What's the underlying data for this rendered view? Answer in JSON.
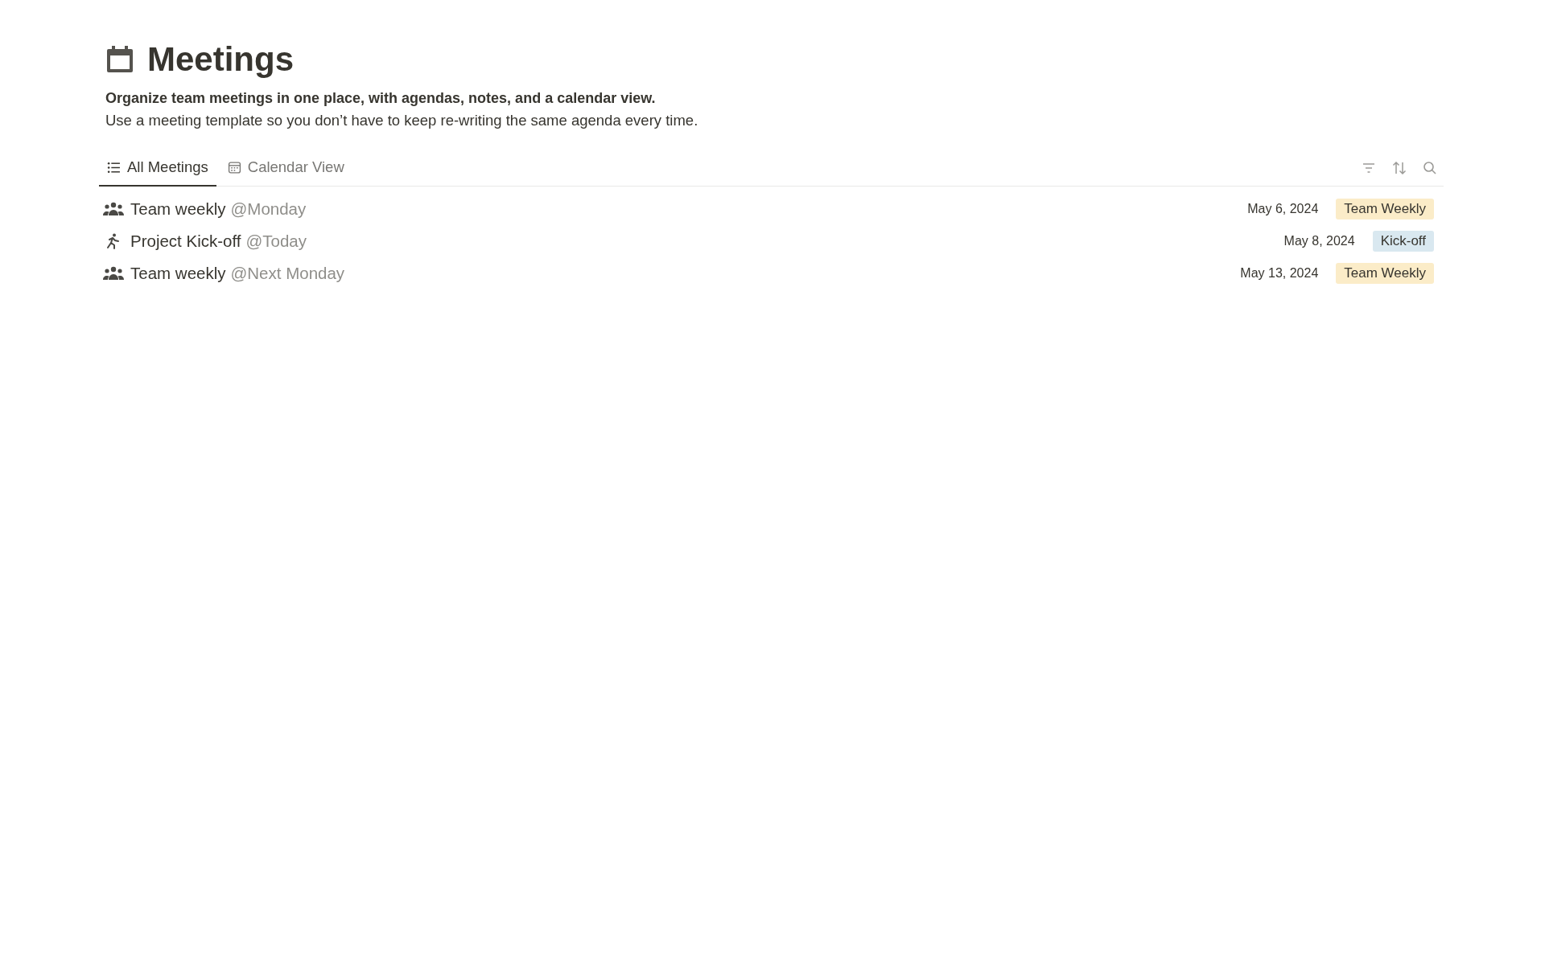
{
  "page": {
    "title": "Meetings",
    "subtitle": "Organize team meetings in one place, with agendas, notes, and a calendar view.",
    "description": "Use a meeting template so you don’t have to keep re-writing the same agenda every time."
  },
  "tabs": [
    {
      "label": "All Meetings",
      "kind": "list",
      "selected": true
    },
    {
      "label": "Calendar View",
      "kind": "calendar",
      "selected": false
    }
  ],
  "rows": [
    {
      "kind": "group",
      "title": "Team weekly",
      "mention": "@Monday",
      "date": "May 6, 2024",
      "tag": "Team Weekly",
      "color": "#fbecc8"
    },
    {
      "kind": "runner",
      "title": "Project Kick-off",
      "mention": "@Today",
      "date": "May 8, 2024",
      "tag": "Kick-off",
      "color": "#d9e8f0"
    },
    {
      "kind": "group",
      "title": "Team weekly",
      "mention": "@Next Monday",
      "date": "May 13, 2024",
      "tag": "Team Weekly",
      "color": "#fbecc8"
    }
  ]
}
